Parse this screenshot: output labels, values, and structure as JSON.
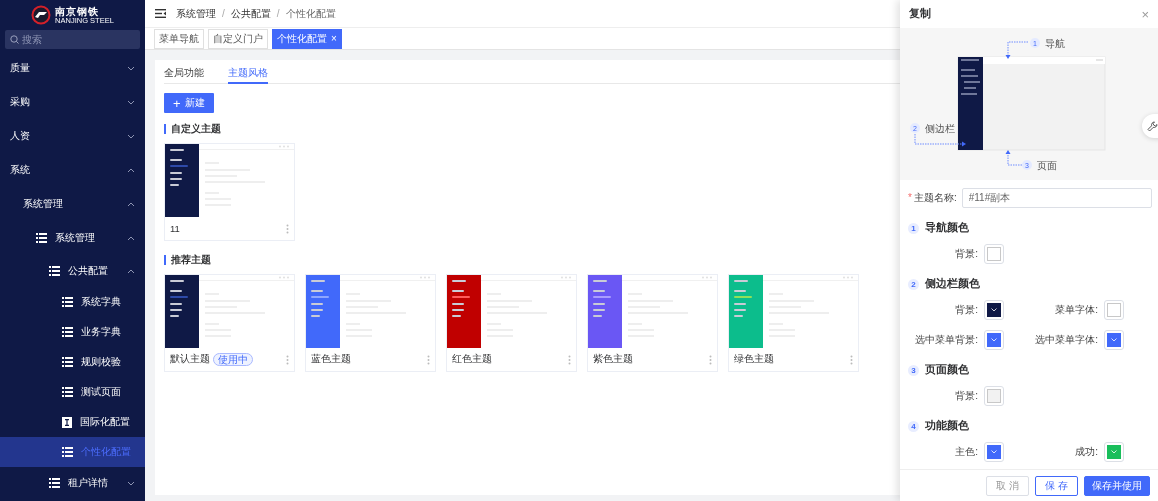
{
  "logo": {
    "name": "南京钢铁",
    "subtitle": "NANJING STEEL"
  },
  "sidebar": {
    "search": {
      "placeholder": "搜索"
    },
    "items": [
      {
        "label": "质量",
        "expanded": false
      },
      {
        "label": "采购",
        "expanded": false
      },
      {
        "label": "人资",
        "expanded": false
      },
      {
        "label": "系统",
        "expanded": true,
        "children": [
          {
            "label": "系统管理",
            "expanded": true,
            "children": [
              {
                "label": "系统管理",
                "kind": "list",
                "expanded": true,
                "children": [
                  {
                    "label": "公共配置",
                    "kind": "list",
                    "expanded": true,
                    "children": [
                      {
                        "label": "系统字典",
                        "kind": "list",
                        "selected": false
                      },
                      {
                        "label": "业务字典",
                        "kind": "list",
                        "selected": false
                      },
                      {
                        "label": "规则校验",
                        "kind": "list",
                        "selected": false
                      },
                      {
                        "label": "测试页面",
                        "kind": "list",
                        "selected": false
                      },
                      {
                        "label": "国际化配置",
                        "kind": "textbox",
                        "selected": false
                      },
                      {
                        "label": "个性化配置",
                        "kind": "list",
                        "selected": true
                      }
                    ]
                  },
                  {
                    "label": "租户详情",
                    "kind": "list",
                    "expanded": false
                  }
                ]
              }
            ]
          }
        ]
      }
    ]
  },
  "breadcrumb": {
    "separator": "/",
    "items": [
      "系统管理",
      "公共配置",
      "个性化配置"
    ]
  },
  "page_tabs": [
    {
      "label": "菜单导航",
      "selected": false
    },
    {
      "label": "自定义门户",
      "selected": false
    },
    {
      "label": "个性化配置",
      "selected": true,
      "close": "×"
    }
  ],
  "content_tabs": [
    {
      "label": "全局功能",
      "selected": false
    },
    {
      "label": "主题风格",
      "selected": true
    }
  ],
  "new_button": {
    "icon": "+",
    "label": "新建"
  },
  "sections": [
    {
      "title": "自定义主题",
      "themes": [
        {
          "name": "11",
          "color": "#0f1946",
          "highlight": {
            "color": "#2e4aa8"
          }
        }
      ]
    },
    {
      "title": "推荐主题",
      "themes": [
        {
          "name": "默认主题",
          "color": "#0f1946",
          "highlight": {
            "color": "#2e4aa8"
          },
          "badge": "使用中"
        },
        {
          "name": "蓝色主题",
          "color": "#4169fa",
          "highlight": {
            "color": "#8ea6ff"
          }
        },
        {
          "name": "红色主题",
          "color": "#c00000",
          "highlight": {
            "color": "#ff5b5b"
          }
        },
        {
          "name": "紫色主题",
          "color": "#6a57f4",
          "highlight": {
            "color": "#a99cff"
          }
        },
        {
          "name": "绿色主题",
          "color": "#0cbd8c",
          "highlight": {
            "color": "#8fe05a"
          }
        }
      ]
    }
  ],
  "drawer": {
    "title": "复制",
    "close": "×",
    "diagram": [
      {
        "number": "1",
        "label": "导航"
      },
      {
        "number": "2",
        "label": "侧边栏"
      },
      {
        "number": "3",
        "label": "页面"
      }
    ],
    "name_field": {
      "required_mark": "*",
      "label": "主题名称:",
      "value": "#11#副本"
    },
    "groups": [
      {
        "number": "1",
        "title": "导航颜色",
        "fields": [
          {
            "label": "背景:",
            "color": "#ffffff"
          }
        ]
      },
      {
        "number": "2",
        "title": "侧边栏颜色",
        "fields": [
          {
            "label": "背景:",
            "color": "#0f1946"
          },
          {
            "label": "菜单字体:",
            "color": "#ffffff"
          },
          {
            "label": "选中菜单背景:",
            "color": "#4169fa"
          },
          {
            "label": "选中菜单字体:",
            "color": "#4169fa"
          }
        ]
      },
      {
        "number": "3",
        "title": "页面颜色",
        "fields": [
          {
            "label": "背景:",
            "color": "#f2f2f2"
          }
        ]
      },
      {
        "number": "4",
        "title": "功能颜色",
        "fields": [
          {
            "label": "主色:",
            "color": "#4169fa"
          },
          {
            "label": "成功:",
            "color": "#19be5b"
          }
        ]
      }
    ],
    "buttons": [
      {
        "label": "取 消",
        "kind": "default"
      },
      {
        "label": "保 存",
        "kind": "outline"
      },
      {
        "label": "保存并使用",
        "kind": "primary"
      }
    ]
  }
}
